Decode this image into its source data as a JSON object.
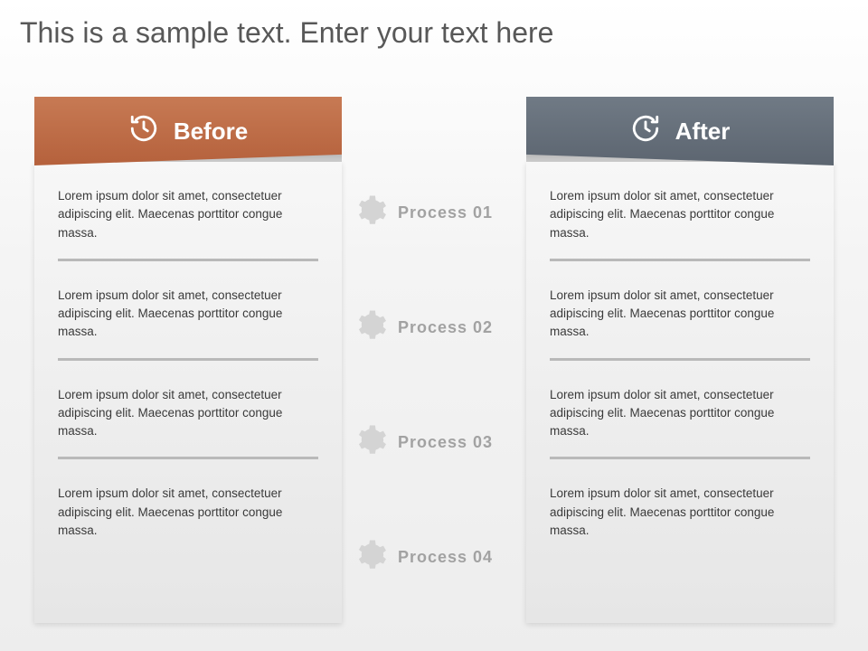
{
  "title": "This is a sample text. Enter your text here",
  "before": {
    "label": "Before",
    "items": [
      "Lorem ipsum dolor sit amet, consectetuer adipiscing elit. Maecenas porttitor congue massa.",
      "Lorem ipsum dolor sit amet, consectetuer adipiscing elit. Maecenas porttitor congue massa.",
      "Lorem ipsum dolor sit amet, consectetuer adipiscing elit. Maecenas porttitor congue massa.",
      "Lorem ipsum dolor sit amet, consectetuer adipiscing elit. Maecenas porttitor congue massa."
    ]
  },
  "after": {
    "label": "After",
    "items": [
      "Lorem ipsum dolor sit amet, consectetuer adipiscing elit. Maecenas porttitor congue massa.",
      "Lorem ipsum dolor sit amet, consectetuer adipiscing elit. Maecenas porttitor congue massa.",
      "Lorem ipsum dolor sit amet, consectetuer adipiscing elit. Maecenas porttitor congue massa.",
      "Lorem ipsum dolor sit amet, consectetuer adipiscing elit. Maecenas porttitor congue massa."
    ]
  },
  "processes": [
    "Process 01",
    "Process 02",
    "Process 03",
    "Process 04"
  ],
  "colors": {
    "before_header": "#b5613c",
    "after_header": "#5c6570",
    "divider": "#b9b9b9",
    "process_text": "#a2a2a2"
  }
}
